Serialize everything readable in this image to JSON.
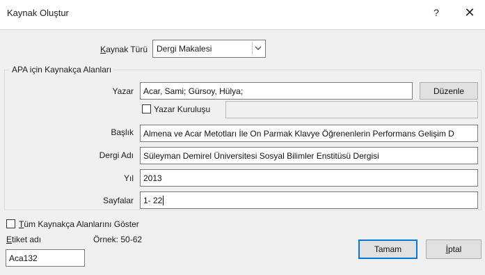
{
  "dialog": {
    "title": "Kaynak Oluştur",
    "help_symbol": "?",
    "close_symbol": "✕"
  },
  "source_type": {
    "label": "Kaynak Türü",
    "label_underline": "K",
    "label_rest": "aynak Türü",
    "value": "Dergi Makalesi"
  },
  "group": {
    "legend": "APA için Kaynakça Alanları"
  },
  "fields": {
    "author": {
      "label": "Yazar",
      "value": "Acar, Sami; Gürsoy, Hülya;"
    },
    "edit_button": "Düzenle",
    "corporate_author": {
      "label": "Yazar Kuruluşu",
      "checked": false,
      "value": ""
    },
    "title": {
      "label": "Başlık",
      "value": "Almena ve Acar Metotları İle On Parmak Klavye Öğrenenlerin Performans Gelişim D"
    },
    "journal": {
      "label": "Dergi Adı",
      "value": "Süleyman Demirel Üniversitesi Sosyal Bilimler Enstitüsü Dergisi"
    },
    "year": {
      "label": "Yıl",
      "value": "2013"
    },
    "pages": {
      "label": "Sayfalar",
      "value": "1- 22"
    }
  },
  "show_all": {
    "label": "Tüm Kaynakça Alanlarını Göster",
    "label_underline": "T",
    "label_rest": "üm Kaynakça Alanlarını Göster",
    "checked": false
  },
  "tag": {
    "label": "Etiket adı",
    "label_underline": "E",
    "label_rest": "tiket adı",
    "value": "Aca132",
    "example": "Örnek: 50-62"
  },
  "buttons": {
    "ok": "Tamam",
    "cancel": "İptal",
    "cancel_underline": "İ",
    "cancel_rest": "ptal"
  },
  "colors": {
    "dialog_bg": "#f0f0f0",
    "default_button_border": "#0078d7"
  },
  "icons": {
    "help": "question-mark",
    "close": "x-mark",
    "dropdown": "chevron-down"
  }
}
